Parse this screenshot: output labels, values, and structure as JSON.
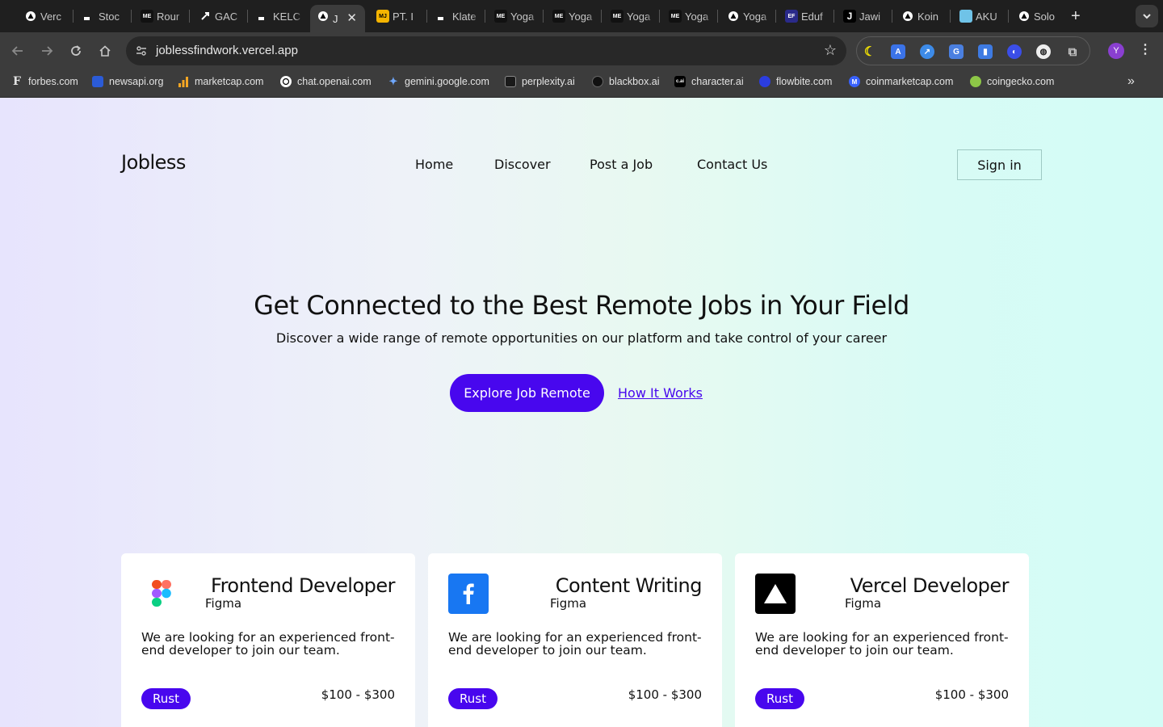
{
  "browser": {
    "tabs": [
      {
        "title": "Verc",
        "icon": "triangle-icon"
      },
      {
        "title": "Stoc",
        "icon": "dash-icon"
      },
      {
        "title": "Rour",
        "icon": "me-icon"
      },
      {
        "title": "GAC",
        "icon": "arrow-icon"
      },
      {
        "title": "KELC",
        "icon": "dash-icon"
      },
      {
        "title": "J",
        "icon": "triangle-icon",
        "active": true
      },
      {
        "title": "PT. I",
        "icon": "mj-icon"
      },
      {
        "title": "Klate",
        "icon": "dash-icon"
      },
      {
        "title": "Yoga",
        "icon": "me-icon"
      },
      {
        "title": "Yoga",
        "icon": "me-icon"
      },
      {
        "title": "Yoga",
        "icon": "me-icon"
      },
      {
        "title": "Yoga",
        "icon": "me-icon"
      },
      {
        "title": "Yoga",
        "icon": "triangle-icon"
      },
      {
        "title": "Eduf",
        "icon": "ef-icon"
      },
      {
        "title": "Jawi",
        "icon": "j-icon"
      },
      {
        "title": "Koin",
        "icon": "triangle-icon"
      },
      {
        "title": "AKU",
        "icon": "image-icon"
      },
      {
        "title": "Solo",
        "icon": "triangle-icon"
      }
    ],
    "url": "joblessfindwork.vercel.app",
    "profile_initial": "Y",
    "bookmarks": [
      {
        "label": "forbes.com",
        "icon": "F"
      },
      {
        "label": "newsapi.org",
        "icon": ""
      },
      {
        "label": "marketcap.com",
        "icon": ""
      },
      {
        "label": "chat.openai.com",
        "icon": ""
      },
      {
        "label": "gemini.google.com",
        "icon": ""
      },
      {
        "label": "perplexity.ai",
        "icon": ""
      },
      {
        "label": "blackbox.ai",
        "icon": ""
      },
      {
        "label": "character.ai",
        "icon": "c.ai"
      },
      {
        "label": "flowbite.com",
        "icon": ""
      },
      {
        "label": "coinmarketcap.com",
        "icon": ""
      },
      {
        "label": "coingecko.com",
        "icon": ""
      }
    ]
  },
  "site": {
    "brand": "Jobless",
    "nav": [
      "Home",
      "Discover",
      "Post a Job",
      "Contact Us"
    ],
    "signin": "Sign in",
    "hero": {
      "title": "Get Connected to the Best Remote Jobs in Your Field",
      "subtitle": "Discover a wide range of remote opportunities on our platform and take control of your career",
      "primary_cta": "Explore Job Remote",
      "secondary_cta": "How It Works"
    },
    "jobs": [
      {
        "title": "Frontend Developer",
        "company": "Figma",
        "description": "We are looking for an experienced front-end developer to join our team.",
        "tag": "Rust",
        "salary": "$100 - $300",
        "logo": "figma-logo-icon"
      },
      {
        "title": "Content Writing",
        "company": "Figma",
        "description": "We are looking for an experienced front-end developer to join our team.",
        "tag": "Rust",
        "salary": "$100 - $300",
        "logo": "facebook-logo-icon"
      },
      {
        "title": "Vercel Developer",
        "company": "Figma",
        "description": "We are looking for an experienced front-end developer to join our team.",
        "tag": "Rust",
        "salary": "$100 - $300",
        "logo": "vercel-logo-icon"
      }
    ],
    "colors": {
      "accent": "#4807ee"
    }
  }
}
